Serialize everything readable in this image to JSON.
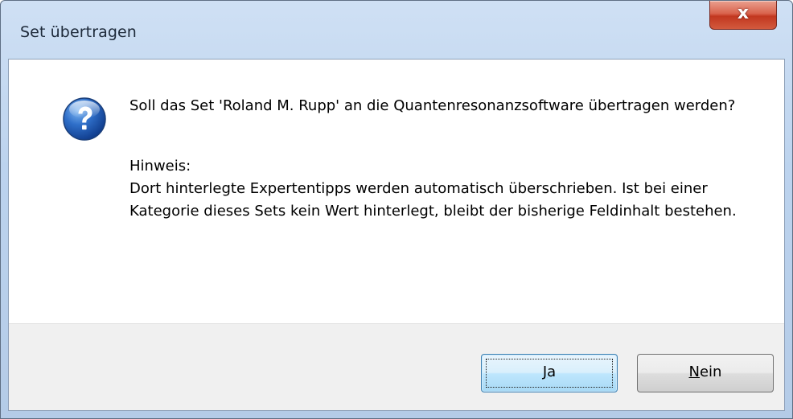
{
  "window": {
    "title": "Set übertragen",
    "close_glyph": "x"
  },
  "dialog": {
    "icon": "question-icon",
    "message": "Soll das Set 'Roland M. Rupp' an die Quantenresonanzsoftware übertragen werden?",
    "hint_label": "Hinweis:",
    "hint_text": "Dort hinterlegte Expertentipps werden automatisch überschrieben. Ist bei einer Kategorie dieses Sets kein Wert hinterlegt, bleibt der bisherige Feldinhalt bestehen."
  },
  "buttons": {
    "yes_mnemonic": "J",
    "yes_rest": "a",
    "no_mnemonic": "N",
    "no_rest": "ein"
  },
  "colors": {
    "titlebar": "#bcd3ee",
    "close": "#c2371f",
    "footer": "#f0f0f0",
    "default_button": "#bee6fd"
  }
}
